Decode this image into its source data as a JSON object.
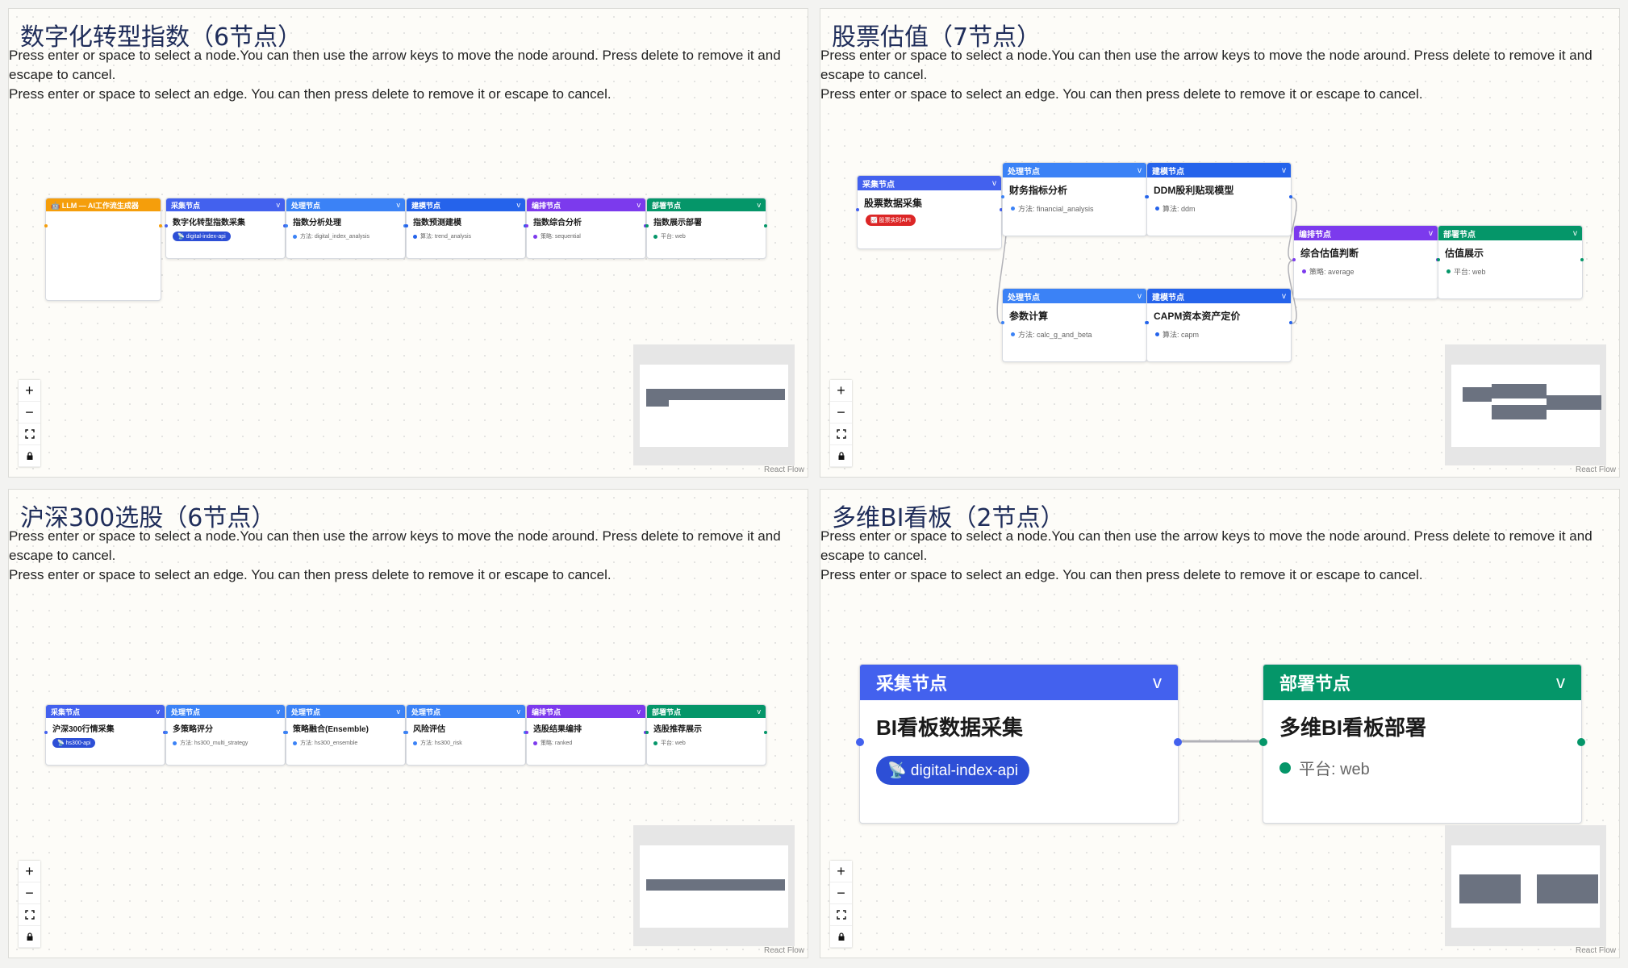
{
  "instructions": {
    "node": "Press enter or space to select a node.You can then use the arrow keys to move the node around. Press delete to remove it and escape to cancel.",
    "edge": "Press enter or space to select an edge. You can then press delete to remove it or escape to cancel."
  },
  "attribution": "React Flow",
  "colors": {
    "collect": "#4361ee",
    "process": "#3b82f6",
    "model": "#2563eb",
    "orchestrate": "#7c3aed",
    "deploy": "#059669",
    "llm": "#f59e0b",
    "chip_blue": "#2d4fd6",
    "chip_red": "#dc2626"
  },
  "panels": [
    {
      "title": "数字化转型指数（6节点）",
      "nodes": [
        {
          "type": "llm",
          "header": "🤖 LLM — AI工作流生成器",
          "title": "",
          "meta": ""
        },
        {
          "type": "collect",
          "header": "采集节点",
          "chevron": "v",
          "title": "数字化转型指数采集",
          "chip": "📡 digital-index-api"
        },
        {
          "type": "process",
          "header": "处理节点",
          "chevron": "v",
          "title": "指数分析处理",
          "meta": "方法: digital_index_analysis"
        },
        {
          "type": "model",
          "header": "建模节点",
          "chevron": "v",
          "title": "指数预测建模",
          "meta": "算法: trend_analysis"
        },
        {
          "type": "orchestrate",
          "header": "编排节点",
          "chevron": "v",
          "title": "指数综合分析",
          "meta": "策略: sequential"
        },
        {
          "type": "deploy",
          "header": "部署节点",
          "chevron": "v",
          "title": "指数展示部署",
          "meta": "平台: web"
        }
      ]
    },
    {
      "title": "股票估值（7节点）",
      "nodes": [
        {
          "type": "collect",
          "header": "采集节点",
          "chevron": "v",
          "title": "股票数据采集",
          "chip": "📈 股票实时API"
        },
        {
          "type": "process",
          "header": "处理节点",
          "chevron": "v",
          "title": "财务指标分析",
          "meta": "方法: financial_analysis"
        },
        {
          "type": "model",
          "header": "建模节点",
          "chevron": "v",
          "title": "DDM股利贴现模型",
          "meta": "算法: ddm"
        },
        {
          "type": "process",
          "header": "处理节点",
          "chevron": "v",
          "title": "参数计算",
          "meta": "方法: calc_g_and_beta"
        },
        {
          "type": "model",
          "header": "建模节点",
          "chevron": "v",
          "title": "CAPM资本资产定价",
          "meta": "算法: capm"
        },
        {
          "type": "orchestrate",
          "header": "编排节点",
          "chevron": "v",
          "title": "综合估值判断",
          "meta": "策略: average"
        },
        {
          "type": "deploy",
          "header": "部署节点",
          "chevron": "v",
          "title": "估值展示",
          "meta": "平台: web"
        }
      ]
    },
    {
      "title": "沪深300选股（6节点）",
      "nodes": [
        {
          "type": "collect",
          "header": "采集节点",
          "chevron": "v",
          "title": "沪深300行情采集",
          "chip": "📡 hs300-api"
        },
        {
          "type": "process",
          "header": "处理节点",
          "chevron": "v",
          "title": "多策略评分",
          "meta": "方法: hs300_multi_strategy"
        },
        {
          "type": "process",
          "header": "处理节点",
          "chevron": "v",
          "title": "策略融合(Ensemble)",
          "meta": "方法: hs300_ensemble"
        },
        {
          "type": "process",
          "header": "处理节点",
          "chevron": "v",
          "title": "风险评估",
          "meta": "方法: hs300_risk"
        },
        {
          "type": "orchestrate",
          "header": "编排节点",
          "chevron": "v",
          "title": "选股结果编排",
          "meta": "策略: ranked"
        },
        {
          "type": "deploy",
          "header": "部署节点",
          "chevron": "v",
          "title": "选股推荐展示",
          "meta": "平台: web"
        }
      ]
    },
    {
      "title": "多维BI看板（2节点）",
      "nodes": [
        {
          "type": "collect",
          "header": "采集节点",
          "chevron": "v",
          "title": "BI看板数据采集",
          "chip": "📡 digital-index-api"
        },
        {
          "type": "deploy",
          "header": "部署节点",
          "chevron": "v",
          "title": "多维BI看板部署",
          "meta": "平台: web"
        }
      ]
    }
  ]
}
